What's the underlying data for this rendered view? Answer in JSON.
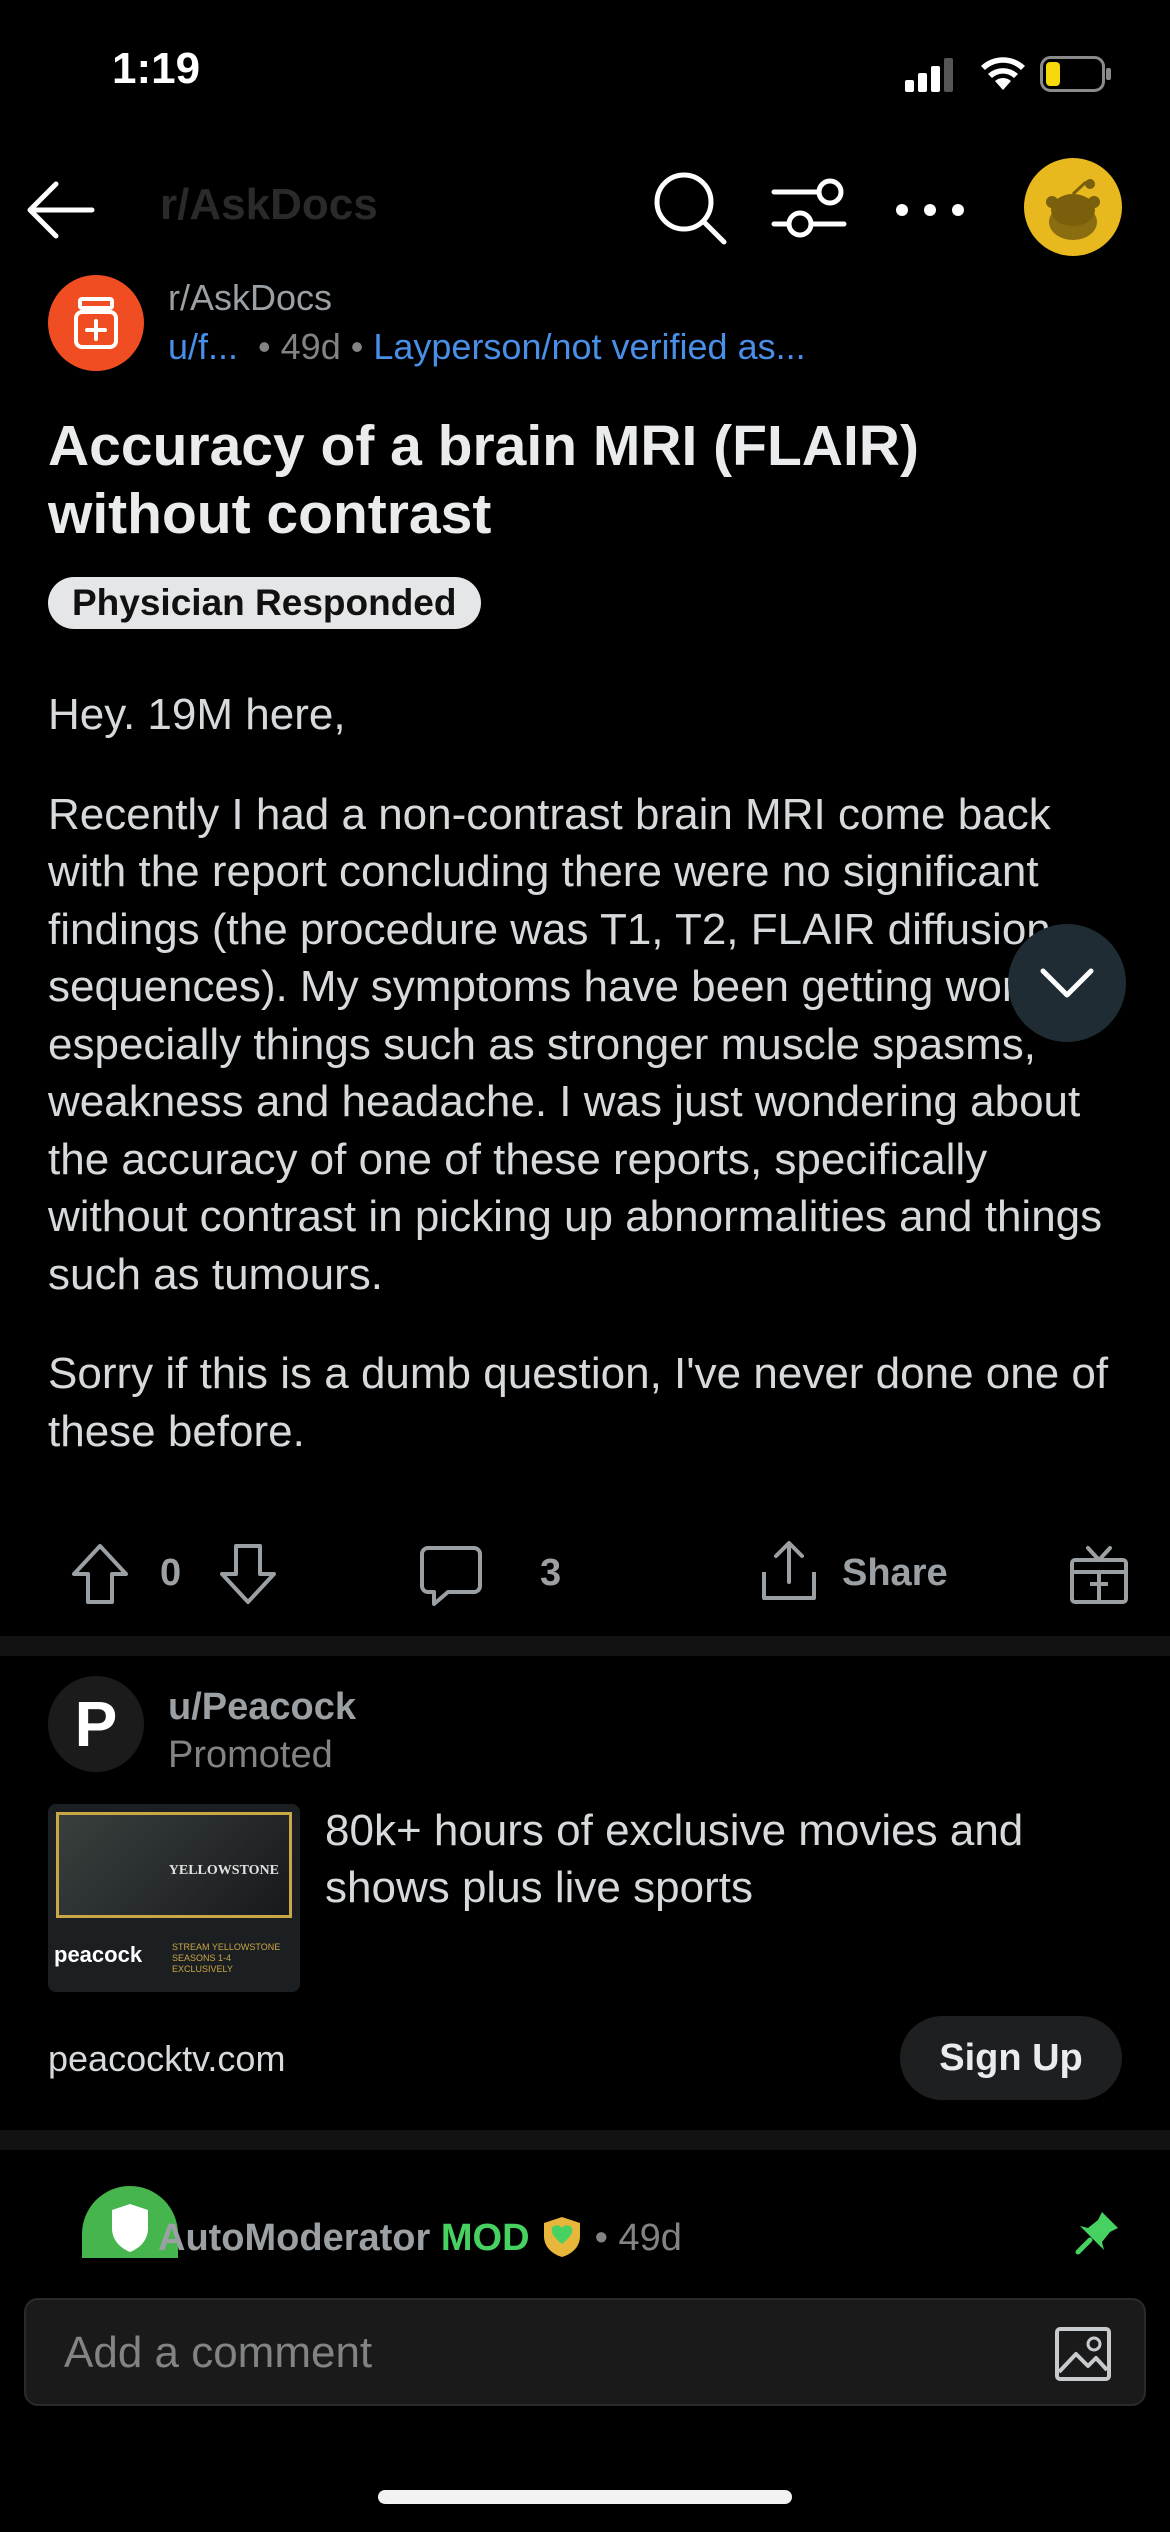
{
  "status_bar": {
    "time": "1:19"
  },
  "nav": {
    "title": "r/AskDocs"
  },
  "post": {
    "subreddit": "r/AskDocs",
    "user": "u/f...",
    "age": "49d",
    "user_flair": "Layperson/not verified as...",
    "title": "Accuracy of a brain MRI (FLAIR) without contrast",
    "post_flair": "Physician Responded",
    "body": [
      "Hey. 19M here,",
      "Recently I had a non-contrast brain MRI come back with the report concluding there were no significant findings (the procedure was T1, T2, FLAIR diffusion sequences). My symptoms have been getting worse, especially things such as stronger muscle spasms, weakness and headache. I was just wondering about the accuracy of one of these reports, specifically without contrast in picking up abnormalities and things such as tumours.",
      "Sorry if this is a dumb question, I've never done one of these before."
    ],
    "votes": "0",
    "comments": "3",
    "share_label": "Share"
  },
  "ad": {
    "avatar_letter": "P",
    "user": "u/Peacock",
    "label": "Promoted",
    "thumb_show": "YELLOWSTONE",
    "thumb_brand": "peacock",
    "thumb_tag": "STREAM YELLOWSTONE SEASONS 1-4 EXCLUSIVELY",
    "headline": "80k+ hours of exclusive movies and shows plus live sports",
    "domain": "peacocktv.com",
    "cta": "Sign Up"
  },
  "comment_preview": {
    "author": "AutoModerator",
    "mod_badge": "MOD",
    "age": "49d"
  },
  "comment_input": {
    "placeholder": "Add a comment"
  },
  "colors": {
    "background": "#000000",
    "link_blue": "#4a8fe7",
    "subreddit_icon": "#f04e22",
    "mod_green": "#46d160",
    "avatar_yellow": "#e8b91e"
  }
}
